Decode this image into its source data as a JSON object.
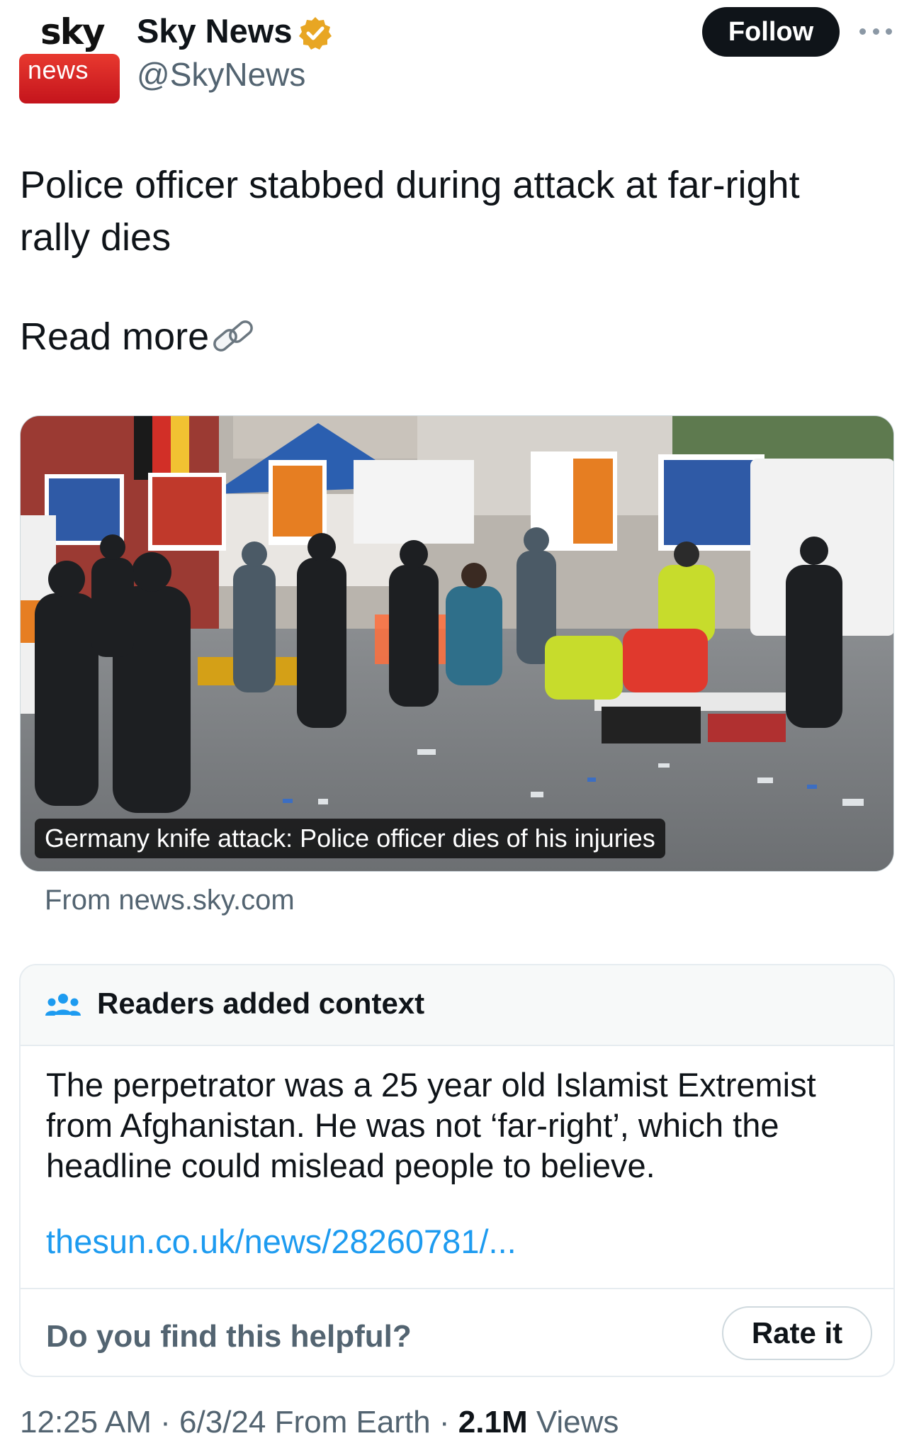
{
  "header": {
    "avatar_top_text": "sky",
    "avatar_bottom_text": "news",
    "display_name": "Sky News",
    "verified_icon": "verified-gold-badge-icon",
    "handle": "@SkyNews",
    "follow_label": "Follow",
    "more_icon": "more-dots-icon"
  },
  "tweet": {
    "text": "Police officer stabbed during attack at far-right rally dies",
    "read_more": "Read more",
    "link_icon": "link-chain-icon"
  },
  "media": {
    "caption": "Germany knife attack: Police officer dies of his injuries",
    "source": "From news.sky.com"
  },
  "community_note": {
    "icon": "people-icon",
    "title": "Readers added context",
    "body": "The perpetrator was a 25 year old Islamist Extremist from Afghanistan. He was not ‘far-right’, which the headline could mislead people to believe.",
    "link": "thesun.co.uk/news/28260781/...",
    "helpful_question": "Do you find this helpful?",
    "rate_label": "Rate it"
  },
  "meta": {
    "time": "12:25 AM",
    "date": "6/3/24",
    "location": "From Earth",
    "views_count": "2.1M",
    "views_label": "Views",
    "separator": "·"
  },
  "colors": {
    "verified_gold": "#e8a623",
    "sky_red": "#d81e24",
    "link_blue": "#1d9bf0",
    "muted_text": "#536471",
    "follow_bg": "#0f1419"
  }
}
